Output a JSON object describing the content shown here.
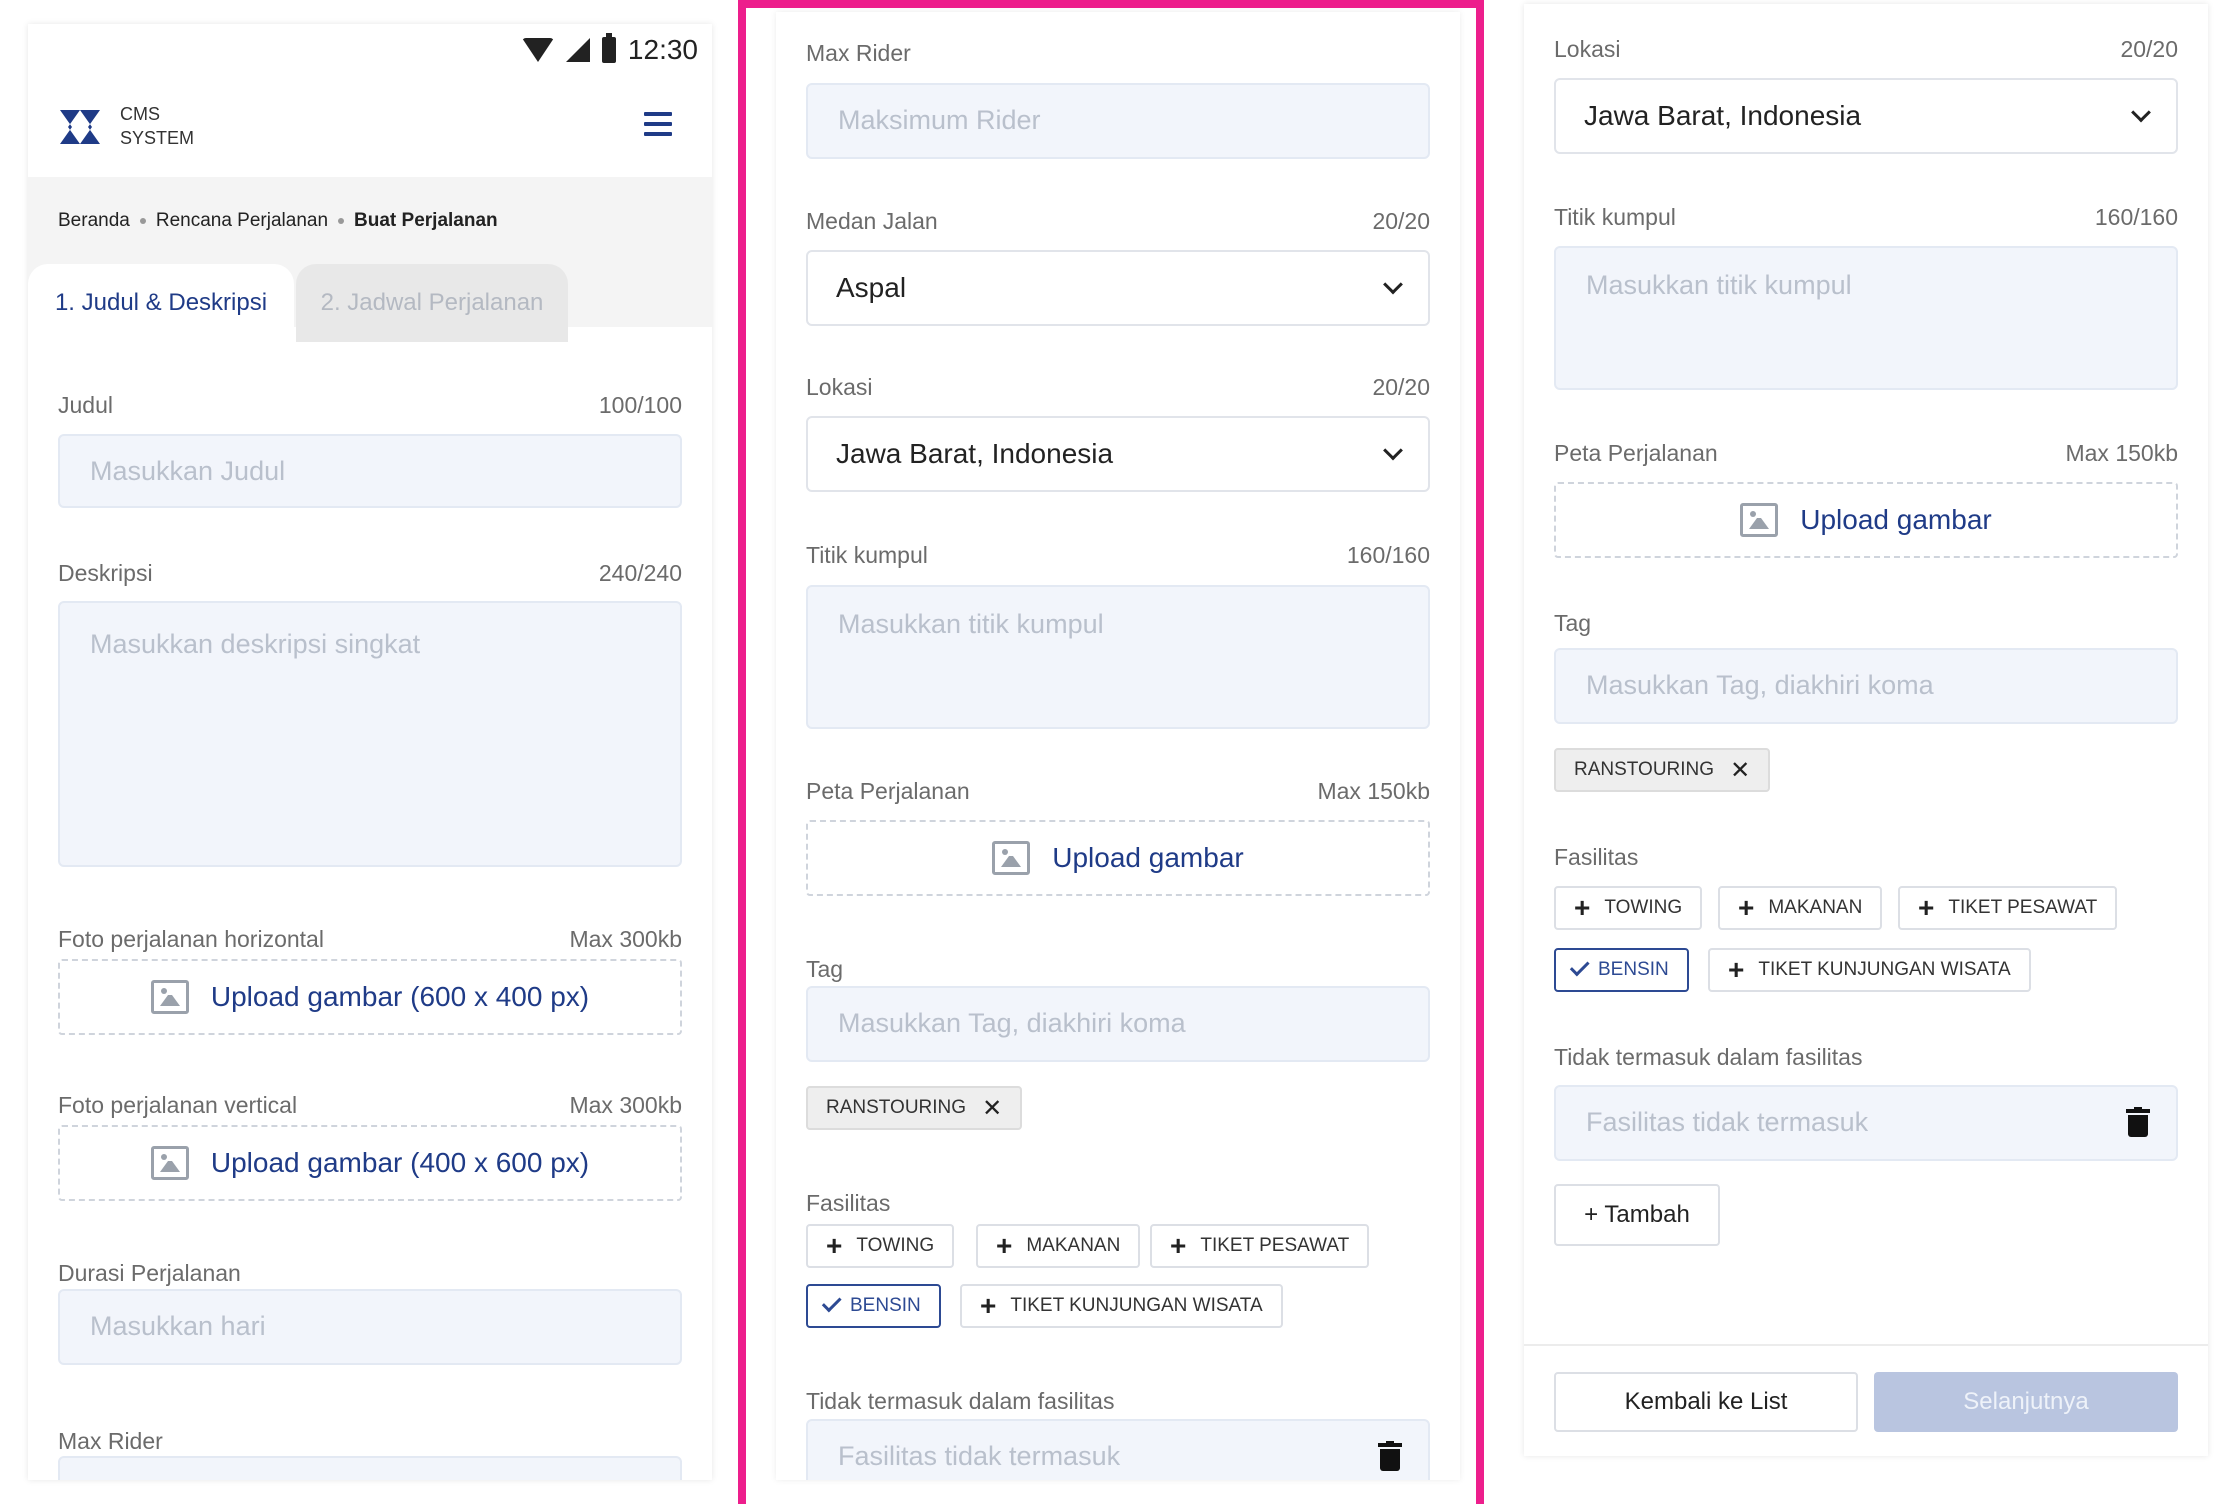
{
  "status_bar": {
    "time": "12:30"
  },
  "app": {
    "brand_line1": "CMS",
    "brand_line2": "SYSTEM"
  },
  "breadcrumb": {
    "items": [
      "Beranda",
      "Rencana Perjalanan",
      "Buat Perjalanan"
    ]
  },
  "tabs": [
    {
      "label": "1. Judul & Deskripsi",
      "active": true
    },
    {
      "label": "2. Jadwal Perjalanan",
      "active": false
    }
  ],
  "form": {
    "judul": {
      "label": "Judul",
      "counter": "100/100",
      "placeholder": "Masukkan Judul"
    },
    "deskripsi": {
      "label": "Deskripsi",
      "counter": "240/240",
      "placeholder": "Masukkan deskripsi singkat"
    },
    "foto_horizontal": {
      "label": "Foto perjalanan horizontal",
      "limit": "Max 300kb",
      "upload_text": "Upload gambar (600 x 400 px)"
    },
    "foto_vertical": {
      "label": "Foto perjalanan vertical",
      "limit": "Max 300kb",
      "upload_text": "Upload gambar (400 x 600 px)"
    },
    "durasi": {
      "label": "Durasi Perjalanan",
      "placeholder": "Masukkan hari"
    },
    "max_rider": {
      "label": "Max Rider",
      "placeholder": "Maksimum Rider"
    },
    "medan_jalan": {
      "label": "Medan Jalan",
      "counter": "20/20",
      "value": "Aspal"
    },
    "lokasi": {
      "label": "Lokasi",
      "counter": "20/20",
      "value": "Jawa Barat, Indonesia"
    },
    "titik_kumpul": {
      "label": "Titik kumpul",
      "counter": "160/160",
      "placeholder": "Masukkan titik kumpul"
    },
    "peta": {
      "label": "Peta Perjalanan",
      "limit": "Max 150kb",
      "upload_text": "Upload gambar"
    },
    "tag": {
      "label": "Tag",
      "placeholder": "Masukkan Tag, diakhiri koma",
      "tags": [
        "RANSTOURING"
      ]
    },
    "fasilitas": {
      "label": "Fasilitas",
      "options": [
        {
          "label": "TOWING",
          "selected": false
        },
        {
          "label": "MAKANAN",
          "selected": false
        },
        {
          "label": "TIKET PESAWAT",
          "selected": false
        },
        {
          "label": "BENSIN",
          "selected": true
        },
        {
          "label": "TIKET KUNJUNGAN WISATA",
          "selected": false
        }
      ]
    },
    "tidak_termasuk": {
      "label": "Tidak termasuk dalam fasilitas",
      "placeholder": "Fasilitas tidak termasuk",
      "add_label": "+ Tambah"
    }
  },
  "footer": {
    "back_label": "Kembali ke List",
    "next_label": "Selanjutnya"
  },
  "colors": {
    "accent": "#1f3b87",
    "frame": "#ed1e8c",
    "disabled_primary": "#b9c5e0"
  },
  "icons": [
    "wifi-icon",
    "signal-icon",
    "battery-icon",
    "logo-icon",
    "hamburger-icon",
    "image-icon",
    "chevron-down-icon",
    "plus-icon",
    "check-icon",
    "close-icon",
    "trash-icon"
  ]
}
